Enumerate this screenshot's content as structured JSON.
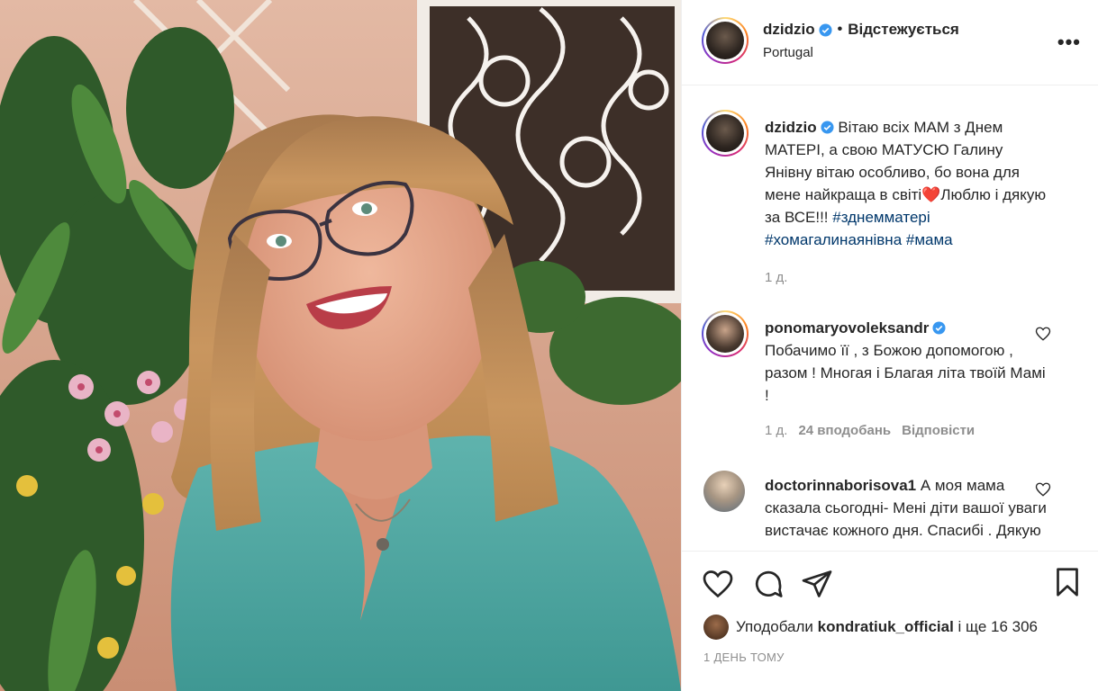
{
  "post": {
    "username": "dzidzio",
    "follow_status": "Відстежується",
    "location": "Portugal",
    "more_glyph": "•••"
  },
  "caption": {
    "username": "dzidzio",
    "text_part1": "Вітаю всіх МАМ з Днем МАТЕРІ, а свою МАТУСЮ Галину Янівну вітаю особливо, бо вона для мене найкраща в світі",
    "emoji": "❤️",
    "text_part2": "Люблю і дякую за ВСЕ!!! ",
    "hashtag1": "#зднемматері",
    "hashtag2": "#хомагалинаянівна",
    "hashtag3": "#мама",
    "time": "1 д."
  },
  "comments": [
    {
      "username": "ponomaryovoleksandr",
      "verified": true,
      "text": "Побачимо її , з Божою допомогою , разом ! Многая і Благая літа твоїй Мамі !",
      "time": "1 д.",
      "likes": "24 вподобань",
      "reply": "Відповісти"
    },
    {
      "username": "doctorinnaborisova1",
      "verified": false,
      "text": "А моя мама сказала сьогодні- Мені діти вашої уваги вистачає кожного дня. Спасибі . Дякую"
    }
  ],
  "likes": {
    "prefix": "Уподобали",
    "user": "kondratiuk_official",
    "suffix": "і ще 16 306"
  },
  "date": "1 ДЕНЬ ТОМУ",
  "icons": [
    "heart-icon",
    "comment-icon",
    "share-icon",
    "bookmark-icon",
    "verified-icon",
    "more-icon"
  ],
  "colors": {
    "verified": "#3897f0",
    "hashtag": "#00376b",
    "muted": "#8e8e8e",
    "heart_emoji": "#e0245e"
  }
}
